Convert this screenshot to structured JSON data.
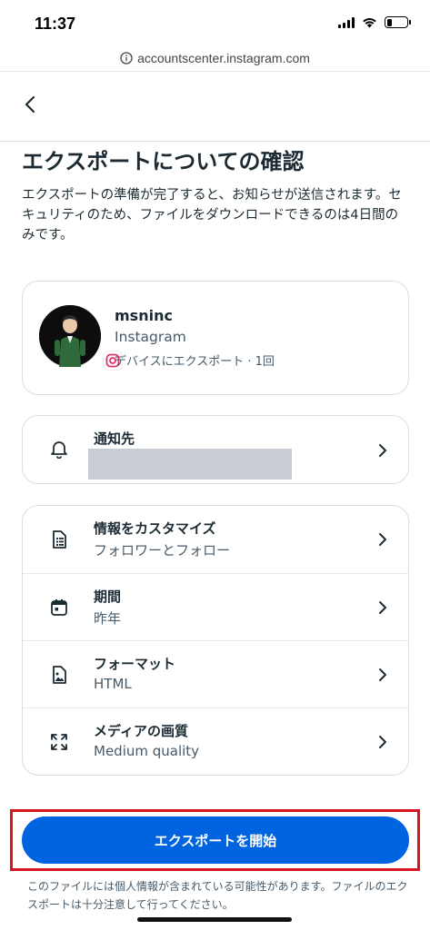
{
  "status_bar": {
    "time": "11:37"
  },
  "browser": {
    "url": "accountscenter.instagram.com"
  },
  "page": {
    "title": "エクスポートについての確認",
    "description": "エクスポートの準備が完了すると、お知らせが送信されます。セキュリティのため、ファイルをダウンロードできるのは4日間のみです。"
  },
  "account": {
    "name": "msninc",
    "platform": "Instagram",
    "detail": "デバイスにエクスポート · 1回"
  },
  "notify": {
    "label": "通知先"
  },
  "settings": {
    "items": [
      {
        "title": "情報をカスタマイズ",
        "value": "フォロワーとフォロー",
        "icon": "document-list-icon"
      },
      {
        "title": "期間",
        "value": "昨年",
        "icon": "calendar-icon"
      },
      {
        "title": "フォーマット",
        "value": "HTML",
        "icon": "image-file-icon"
      },
      {
        "title": "メディアの画質",
        "value": "Medium quality",
        "icon": "expand-arrows-icon"
      }
    ]
  },
  "cta": {
    "label": "エクスポートを開始"
  },
  "footer": {
    "note": "このファイルには個人情報が含まれている可能性があります。ファイルのエクスポートは十分注意して行ってください。"
  },
  "colors": {
    "primary": "#0064e0",
    "highlight": "#d8141e",
    "text": "#1c2b33",
    "secondary_text": "#465a69",
    "border": "#d9dee3"
  }
}
